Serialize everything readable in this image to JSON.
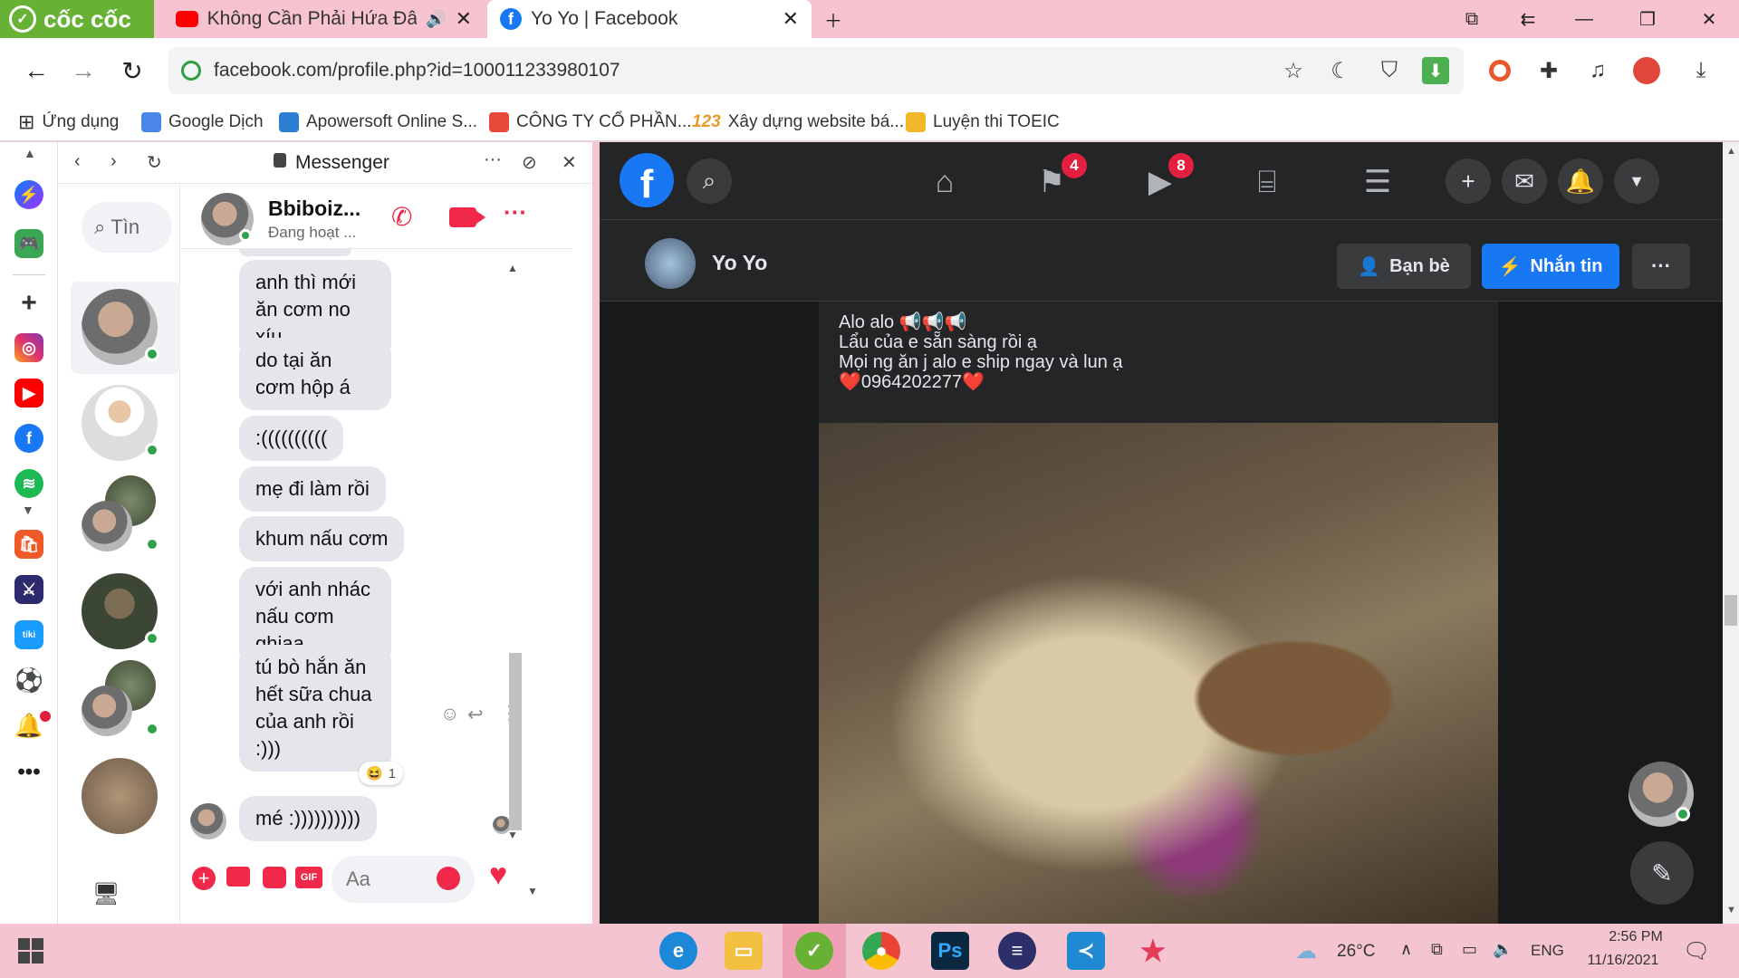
{
  "browser": {
    "brand": "cốc cốc",
    "tabs": [
      {
        "title": "Không Cần Phải Hứa Đâu",
        "active": false
      },
      {
        "title": "Yo Yo | Facebook",
        "active": true
      }
    ],
    "address": "facebook.com/profile.php?id=100011233980107",
    "bookmarks": [
      "Ứng dụng",
      "Google Dịch",
      "Apowersoft Online S...",
      "CÔNG TY CỔ PHẦN...",
      "Xây dựng website bá...",
      "Luyện thi TOEIC"
    ]
  },
  "messenger": {
    "title": "Messenger",
    "search_placeholder": "Tìn",
    "contact": {
      "name": "Bbiboiz...",
      "status": "Đang hoạt ..."
    },
    "messages": [
      "anh thì mới ăn cơm no xíu",
      "do tại ăn cơm hộp á",
      ":((((((((((",
      "mẹ đi làm rồi",
      "khum nấu cơm",
      "với  anh nhác nấu cơm ghiaa",
      "tú bò hắn ăn hết sữa chua của anh rồi :)))",
      "mé :))))))))))"
    ],
    "reaction_count": "1",
    "composer_placeholder": "Aa"
  },
  "facebook": {
    "badges": {
      "flag": "4",
      "video": "8"
    },
    "profile_name": "Yo Yo",
    "friends_button": "Bạn bè",
    "message_button": "Nhắn tin",
    "post_lines": [
      "Alo alo 📢📢📢",
      "Lẩu của e sẵn sàng rồi ạ",
      "Mọi ng ăn j alo e ship ngay và lun ạ",
      "❤️0964202277❤️"
    ]
  },
  "taskbar": {
    "weather": "26°C",
    "language": "ENG",
    "time": "2:56 PM",
    "date": "11/16/2021"
  },
  "colors": {
    "tab_bar": "#f7c3cf",
    "brand_green": "#67b234",
    "fb_blue": "#1877f2",
    "fb_dark": "#242526",
    "badge_red": "#e41e3f",
    "messenger_red": "#f02849"
  }
}
